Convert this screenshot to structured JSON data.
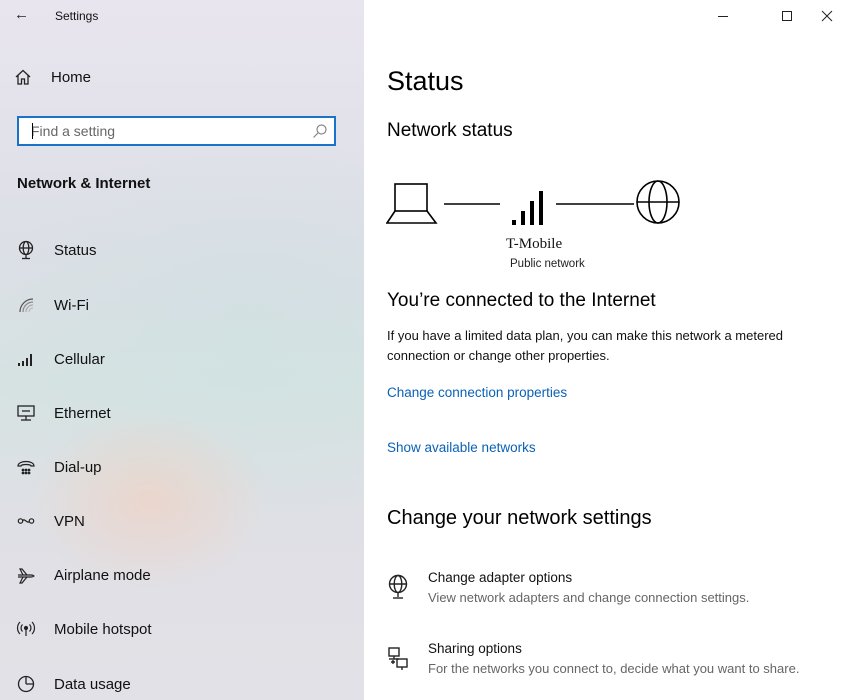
{
  "window": {
    "title": "Settings",
    "controls": [
      {
        "name": "minimize-icon"
      },
      {
        "name": "maximize-icon"
      },
      {
        "name": "close-icon"
      }
    ]
  },
  "sidebar": {
    "home_label": "Home",
    "search": {
      "placeholder": "Find a setting",
      "value": ""
    },
    "section_title": "Network & Internet",
    "items": [
      {
        "label": "Status",
        "icon": "status-globe-icon"
      },
      {
        "label": "Wi-Fi",
        "icon": "wifi-icon"
      },
      {
        "label": "Cellular",
        "icon": "cellular-icon"
      },
      {
        "label": "Ethernet",
        "icon": "ethernet-icon"
      },
      {
        "label": "Dial-up",
        "icon": "dialup-icon"
      },
      {
        "label": "VPN",
        "icon": "vpn-icon"
      },
      {
        "label": "Airplane mode",
        "icon": "airplane-icon"
      },
      {
        "label": "Mobile hotspot",
        "icon": "hotspot-icon"
      },
      {
        "label": "Data usage",
        "icon": "data-usage-icon"
      }
    ]
  },
  "main": {
    "title": "Status",
    "network_status_heading": "Network status",
    "network": {
      "name": "T-Mobile",
      "type": "Public network"
    },
    "connected_heading": "You’re connected to the Internet",
    "connected_desc": "If you have a limited data plan, you can make this network a metered connection or change other properties.",
    "links": {
      "change_connection": "Change connection properties",
      "show_networks": "Show available networks"
    },
    "change_settings_heading": "Change your network settings",
    "options": [
      {
        "title": "Change adapter options",
        "desc": "View network adapters and change connection settings.",
        "icon": "adapter-icon"
      },
      {
        "title": "Sharing options",
        "desc": "For the networks you connect to, decide what you want to share.",
        "icon": "sharing-icon"
      }
    ]
  }
}
